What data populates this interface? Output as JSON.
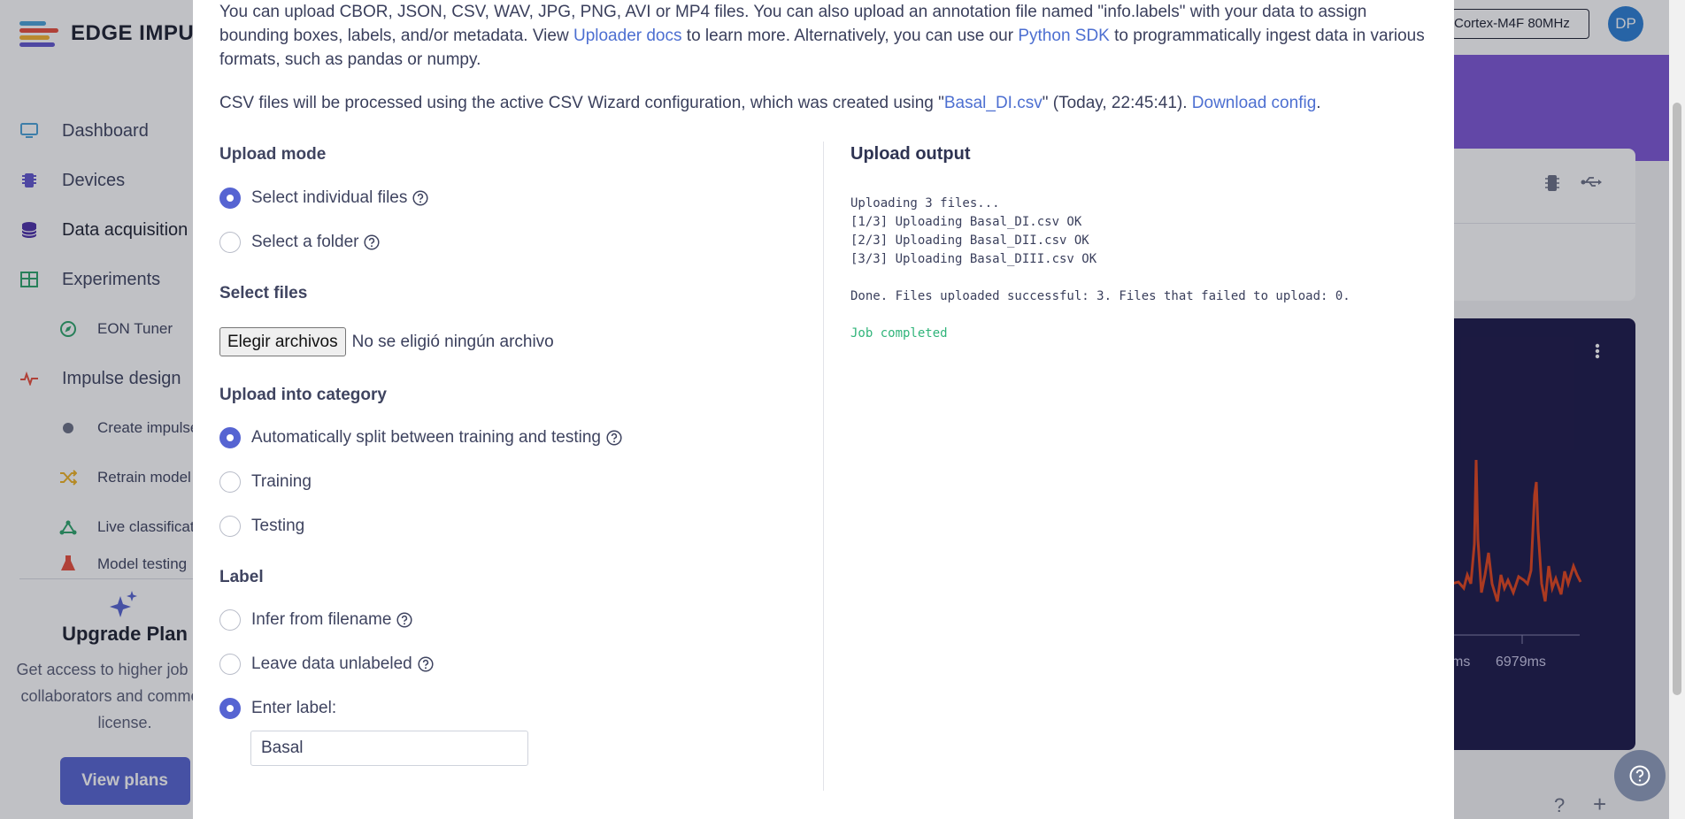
{
  "brand": {
    "name": "EDGE IMPULSE"
  },
  "nav": {
    "items": [
      {
        "label": "Dashboard"
      },
      {
        "label": "Devices"
      },
      {
        "label": "Data acquisition"
      },
      {
        "label": "Experiments"
      },
      {
        "label": "EON Tuner"
      },
      {
        "label": "Impulse design"
      },
      {
        "label": "Create impulse"
      },
      {
        "label": "Retrain model"
      },
      {
        "label": "Live classification"
      },
      {
        "label": "Model testing"
      }
    ]
  },
  "upgrade": {
    "title": "Upgrade Plan",
    "text": "Get access to higher job limits, collaborators and commercial license.",
    "button": "View plans"
  },
  "topbar": {
    "device": "Cortex-M4F 80MHz",
    "avatar": "DP"
  },
  "background_chart": {
    "tick_labels": [
      "ms",
      "6979ms"
    ]
  },
  "modal": {
    "intro_parts": [
      "You can upload CBOR, JSON, CSV, WAV, JPG, PNG, AVI or MP4 files. You can also upload an annotation file named \"info.labels\" with your data to assign bounding boxes, labels, and/or metadata. View ",
      "Uploader docs",
      " to learn more. Alternatively, you can use our ",
      "Python SDK",
      " to programmatically ingest data in various formats, such as pandas or numpy."
    ],
    "csv_note_parts": [
      "CSV files will be processed using the active CSV Wizard configuration, which was created using \"",
      "Basal_DI.csv",
      "\" (Today, 22:45:41). ",
      "Download config",
      "."
    ],
    "upload_mode": {
      "title": "Upload mode",
      "options": [
        "Select individual files",
        "Select a folder"
      ],
      "selected": 0
    },
    "select_files": {
      "title": "Select files",
      "button": "Elegir archivos",
      "status": "No se eligió ningún archivo"
    },
    "category": {
      "title": "Upload into category",
      "options": [
        "Automatically split between training and testing",
        "Training",
        "Testing"
      ],
      "selected": 0
    },
    "label": {
      "title": "Label",
      "options": [
        "Infer from filename",
        "Leave data unlabeled",
        "Enter label:"
      ],
      "selected": 2,
      "value": "Basal"
    },
    "output": {
      "title": "Upload output",
      "lines": [
        "Uploading 3 files...",
        "[1/3] Uploading Basal_DI.csv OK",
        "[2/3] Uploading Basal_DII.csv OK",
        "[3/3] Uploading Basal_DIII.csv OK",
        "",
        "Done. Files uploaded successful: 3. Files that failed to upload: 0.",
        "",
        "Job completed"
      ]
    }
  },
  "colors": {
    "accent": "#5664d2",
    "link": "#4d6fd1",
    "success": "#30b47a",
    "chart_bg": "#1b1848",
    "signal": "#e2451d"
  }
}
